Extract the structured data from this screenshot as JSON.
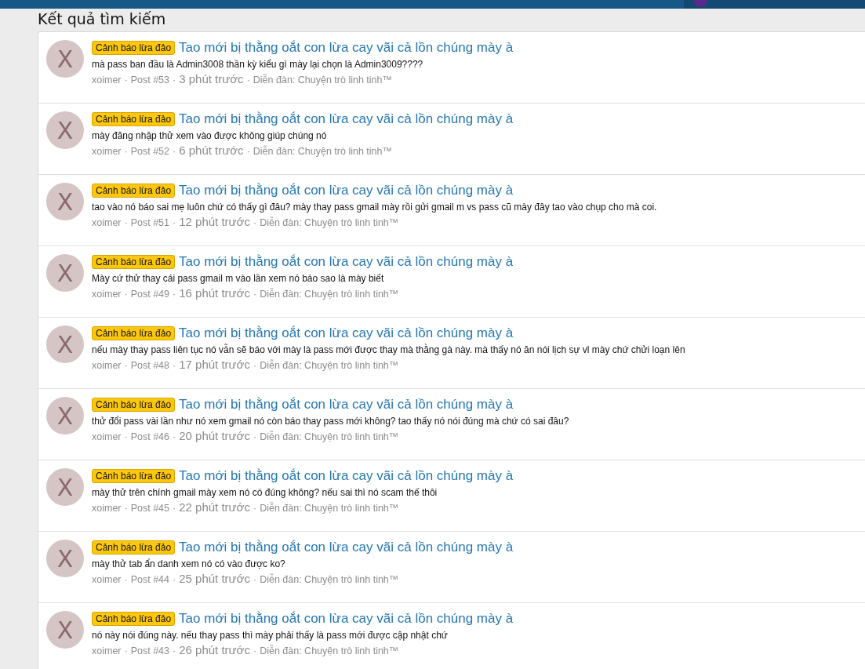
{
  "heading": "Kết quả tìm kiếm",
  "separator": "·",
  "results": [
    {
      "avatar": "X",
      "prefix": "Cảnh báo lừa đảo",
      "title": "Tao mới bị thằng oắt con lừa cay vãi cả lồn chúng mày à",
      "snippet": "mà pass ban đầu là Admin3008 thần kỳ kiểu gì mày lại chọn là Admin3009????",
      "author": "xoimer",
      "post": "Post #53",
      "time": "3 phút trước",
      "forum": "Diễn đàn: Chuyện trò linh tinh™"
    },
    {
      "avatar": "X",
      "prefix": "Cảnh báo lừa đảo",
      "title": "Tao mới bị thằng oắt con lừa cay vãi cả lồn chúng mày à",
      "snippet": "mày đăng nhập thử xem vào được không giúp chúng nó",
      "author": "xoimer",
      "post": "Post #52",
      "time": "6 phút trước",
      "forum": "Diễn đàn: Chuyện trò linh tinh™"
    },
    {
      "avatar": "X",
      "prefix": "Cảnh báo lừa đảo",
      "title": "Tao mới bị thằng oắt con lừa cay vãi cả lồn chúng mày à",
      "snippet": "tao vào nó báo sai mẹ luôn chứ có thấy gì đâu? mày thay pass gmail mày rồi gửi gmail m vs pass cũ mày đây tao vào chụp cho mà coi.",
      "author": "xoimer",
      "post": "Post #51",
      "time": "12 phút trước",
      "forum": "Diễn đàn: Chuyện trò linh tinh™"
    },
    {
      "avatar": "X",
      "prefix": "Cảnh báo lừa đảo",
      "title": "Tao mới bị thằng oắt con lừa cay vãi cả lồn chúng mày à",
      "snippet": "Mày cứ thử thay cái pass gmail m vào lần xem nó báo sao là mày biết",
      "author": "xoimer",
      "post": "Post #49",
      "time": "16 phút trước",
      "forum": "Diễn đàn: Chuyện trò linh tinh™"
    },
    {
      "avatar": "X",
      "prefix": "Cảnh báo lừa đảo",
      "title": "Tao mới bị thằng oắt con lừa cay vãi cả lồn chúng mày à",
      "snippet": "nếu mày thay pass liên tục nó vẫn sẽ báo với mày là pass mới được thay mà thằng gà này. mà thấy nó ăn nói lịch sự vl mày chứ chửi loạn lên",
      "author": "xoimer",
      "post": "Post #48",
      "time": "17 phút trước",
      "forum": "Diễn đàn: Chuyện trò linh tinh™"
    },
    {
      "avatar": "X",
      "prefix": "Cảnh báo lừa đảo",
      "title": "Tao mới bị thằng oắt con lừa cay vãi cả lồn chúng mày à",
      "snippet": "thử đổi pass vài lần như nó xem gmail nó còn báo thay pass mới không? tao thấy nó nói đúng mà chứ có sai đâu?",
      "author": "xoimer",
      "post": "Post #46",
      "time": "20 phút trước",
      "forum": "Diễn đàn: Chuyện trò linh tinh™"
    },
    {
      "avatar": "X",
      "prefix": "Cảnh báo lừa đảo",
      "title": "Tao mới bị thằng oắt con lừa cay vãi cả lồn chúng mày à",
      "snippet": "mày thử trên chính gmail mày xem nó có đúng không? nếu sai thì nó scam thế thôi",
      "author": "xoimer",
      "post": "Post #45",
      "time": "22 phút trước",
      "forum": "Diễn đàn: Chuyện trò linh tinh™"
    },
    {
      "avatar": "X",
      "prefix": "Cảnh báo lừa đảo",
      "title": "Tao mới bị thằng oắt con lừa cay vãi cả lồn chúng mày à",
      "snippet": "mày thử tab ẩn danh xem nó có vào được ko?",
      "author": "xoimer",
      "post": "Post #44",
      "time": "25 phút trước",
      "forum": "Diễn đàn: Chuyện trò linh tinh™"
    },
    {
      "avatar": "X",
      "prefix": "Cảnh báo lừa đảo",
      "title": "Tao mới bị thằng oắt con lừa cay vãi cả lồn chúng mày à",
      "snippet": "nó này nói đúng này. nếu thay pass thì mày phải thấy là pass mới được cập nhật chứ",
      "author": "xoimer",
      "post": "Post #43",
      "time": "26 phút trước",
      "forum": "Diễn đàn: Chuyện trò linh tinh™"
    }
  ]
}
